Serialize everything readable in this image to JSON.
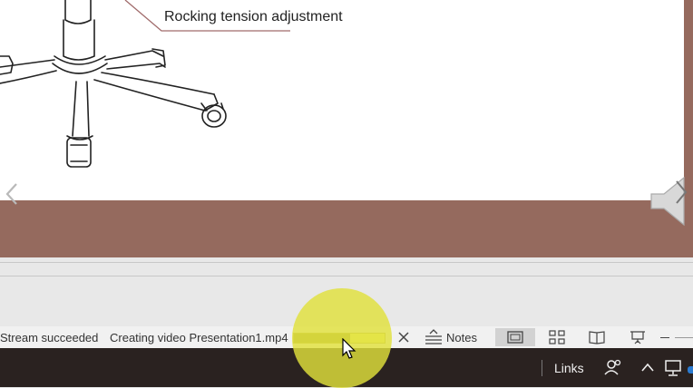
{
  "slide": {
    "callout_label": "Rocking tension adjustment"
  },
  "statusbar": {
    "stream_status": "Stream succeeded",
    "video_status": "Creating video Presentation1.mp4",
    "progress": 0.62,
    "notes_label": "Notes",
    "views": [
      "normal-view-icon",
      "slide-sorter-icon",
      "reading-view-icon",
      "slide-show-icon"
    ]
  },
  "taskbar": {
    "links_label": "Links"
  },
  "colors": {
    "stage_background": "#956a5e",
    "cursor_highlight": "#e1e13c",
    "progress_fill": "#9c9a3c",
    "taskbar": "#2a2220"
  }
}
